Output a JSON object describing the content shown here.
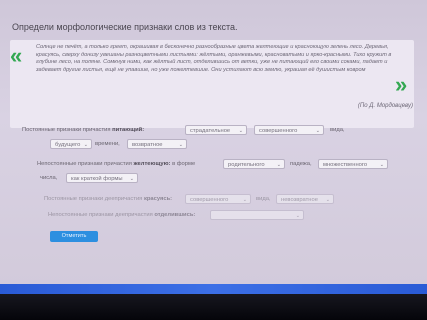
{
  "title": "Определи морфологические признаки слов из текста.",
  "quote": {
    "text": "Солнце не печёт, а только греет, окрашивая в бесконечно разнообразные цвета желтеющие и красноющую зелень лесо. Деревья, красуясь, сверху донизу увешаны разноцветными листьями: жёлтыми, оранжевыми, красноватыми и ярко-красными. Тихо кружит в глубине лесо, на поляне. Сомкнув ними, как жёлтый лист, отделившись от ветки, уже не питающий его своими соками, падает и задевает другие листья, ещё не упавшие, но уже пожелтевшие. Они устилают всю землю, украшая её душистым ковром",
    "author": "(По Д. Мордовцеву)"
  },
  "q1": {
    "prefix": "Постоянные признаки причастия",
    "word": "питающий:",
    "opt1": "страдательное",
    "opt2": "совершенного",
    "mid": "вида,",
    "opt3": "будущего",
    "mid2": "времени,",
    "opt4": "возвратное"
  },
  "q2": {
    "prefix": "Непостоянные признаки причастия",
    "word": "желтеющую:",
    "form_label": "в форме",
    "opt1": "родительного",
    "mid": "падежа,",
    "opt2": "множественного",
    "num_label": "числа,",
    "opt3": "как краткой формы"
  },
  "q3": {
    "prefix": "Постоянные признаки деепричастия",
    "word": "красуясь:",
    "opt1": "совершенного",
    "mid": "вида,",
    "opt2": "невозвратное"
  },
  "q4": {
    "prefix": "Непостоянные признаки деепричастия",
    "word": "отделившись:",
    "opt1": ""
  },
  "check_button": "Отметить"
}
